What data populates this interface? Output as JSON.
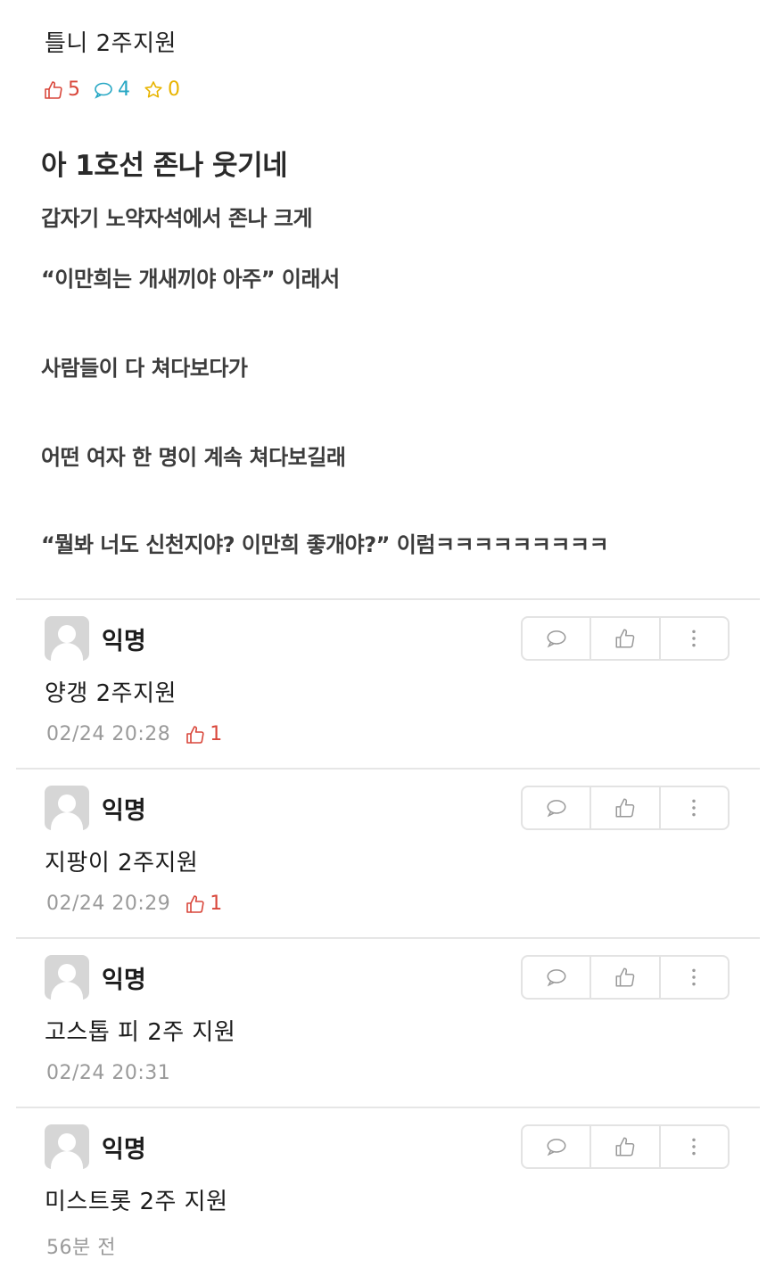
{
  "post": {
    "subtitle": "틀니 2주지원",
    "stats": {
      "likes": "5",
      "comments": "4",
      "scraps": "0"
    },
    "title": "아 1호선 존나 웃기네",
    "lines": [
      "갑자기 노약자석에서 존나 크게",
      "“이만희는 개새끼야 아주” 이래서",
      "사람들이 다 쳐다보다가",
      "어떤 여자 한 명이 계속 쳐다보길래",
      "“뭘봐 너도 신천지야? 이만희 좋개야?” 이럼ㅋㅋㅋㅋㅋㅋㅋㅋㅋ"
    ]
  },
  "comments": [
    {
      "author": "익명",
      "text": "양갱 2주지원",
      "time": "02/24 20:28",
      "likes": "1"
    },
    {
      "author": "익명",
      "text": "지팡이 2주지원",
      "time": "02/24 20:29",
      "likes": "1"
    },
    {
      "author": "익명",
      "text": "고스톱 피 2주 지원",
      "time": "02/24 20:31",
      "likes": ""
    },
    {
      "author": "익명",
      "text": "미스트롯 2주 지원",
      "time": "56분 전",
      "likes": ""
    }
  ],
  "icons": {
    "like": "thumbs-up-icon",
    "comment": "speech-bubble-icon",
    "scrap": "star-icon",
    "more": "vertical-dots-icon"
  },
  "colors": {
    "like": "#d9473b",
    "comment": "#26a7c4",
    "scrap": "#e8b400",
    "meta": "#9a9a9a"
  }
}
